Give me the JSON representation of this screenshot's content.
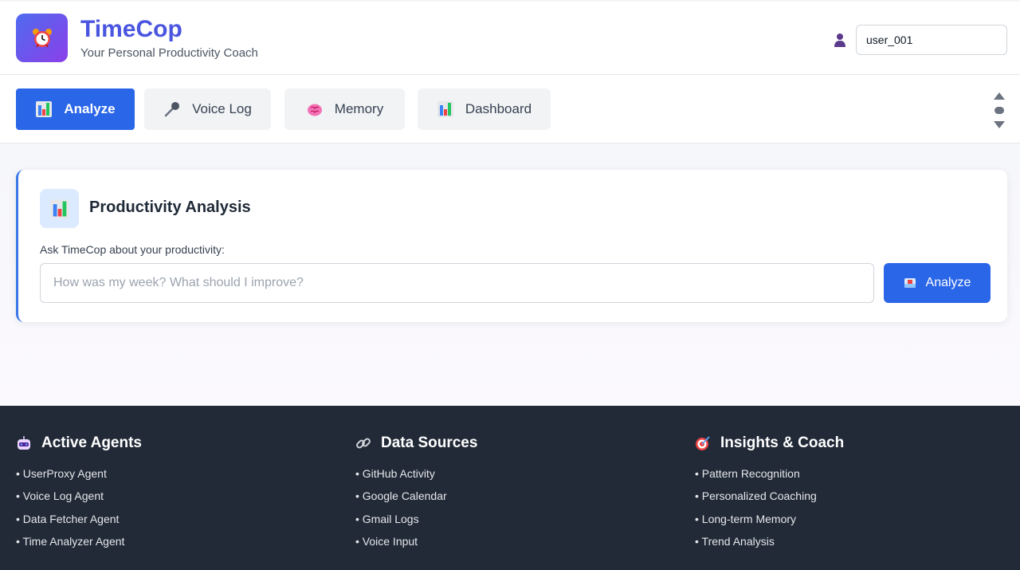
{
  "header": {
    "app_name": "TimeCop",
    "tagline": "Your Personal Productivity Coach",
    "logo_icon": "alarm-clock-icon",
    "user_id_value": "user_001"
  },
  "tabs": [
    {
      "label": "Analyze",
      "icon": "bar-chart-icon",
      "active": true
    },
    {
      "label": "Voice Log",
      "icon": "microphone-icon",
      "active": false
    },
    {
      "label": "Memory",
      "icon": "brain-icon",
      "active": false
    },
    {
      "label": "Dashboard",
      "icon": "bar-chart-icon",
      "active": false
    }
  ],
  "analysis": {
    "title": "Productivity Analysis",
    "prompt_label": "Ask TimeCop about your productivity:",
    "input_placeholder": "How was my week? What should I improve?",
    "input_value": "",
    "button_label": "Analyze"
  },
  "footer": {
    "agents": {
      "heading": "Active Agents",
      "icon": "robot-icon",
      "items": [
        "• UserProxy Agent",
        "• Voice Log Agent",
        "• Data Fetcher Agent",
        "• Time Analyzer Agent"
      ]
    },
    "sources": {
      "heading": "Data Sources",
      "icon": "link-icon",
      "items": [
        "• GitHub Activity",
        "• Google Calendar",
        "• Gmail Logs",
        "• Voice Input"
      ]
    },
    "insights": {
      "heading": "Insights & Coach",
      "icon": "target-icon",
      "items": [
        "• Pattern Recognition",
        "• Personalized Coaching",
        "• Long-term Memory",
        "• Trend Analysis"
      ]
    }
  },
  "colors": {
    "brand": "#4a55e0",
    "primary": "#2a66e8",
    "footer_bg": "#222a37"
  }
}
